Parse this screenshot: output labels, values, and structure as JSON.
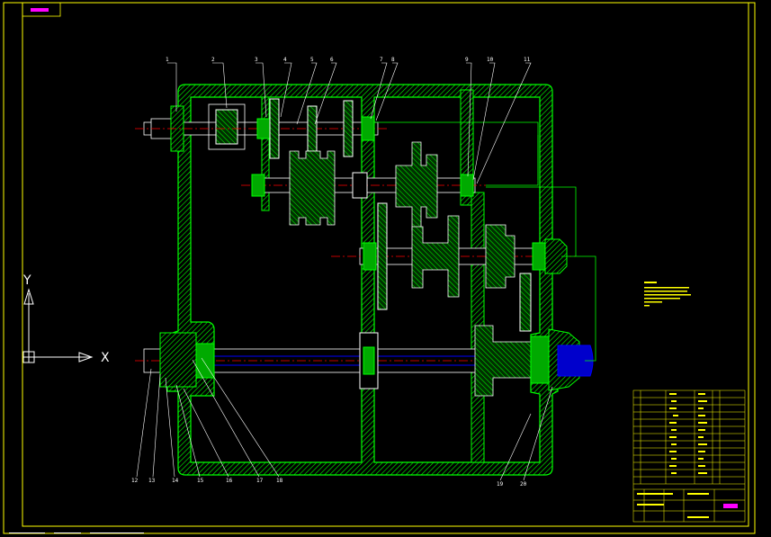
{
  "drawing": {
    "part_numbers": [
      "1",
      "2",
      "3",
      "4",
      "5",
      "6",
      "7",
      "8",
      "9",
      "10",
      "11",
      "12",
      "13",
      "14",
      "15",
      "16",
      "17",
      "18",
      "19",
      "20"
    ],
    "axis_labels": {
      "x": "X",
      "y": "Y"
    },
    "colors": {
      "background": "#000000",
      "frame": "#ffff00",
      "housing": "#00ff00",
      "outline": "#ffffff",
      "centerline": "#ff0000",
      "dimension": "#00ff00",
      "shaft_core": "#0000ff",
      "title_block": "#ffff00",
      "accent": "#ff00ff"
    }
  }
}
